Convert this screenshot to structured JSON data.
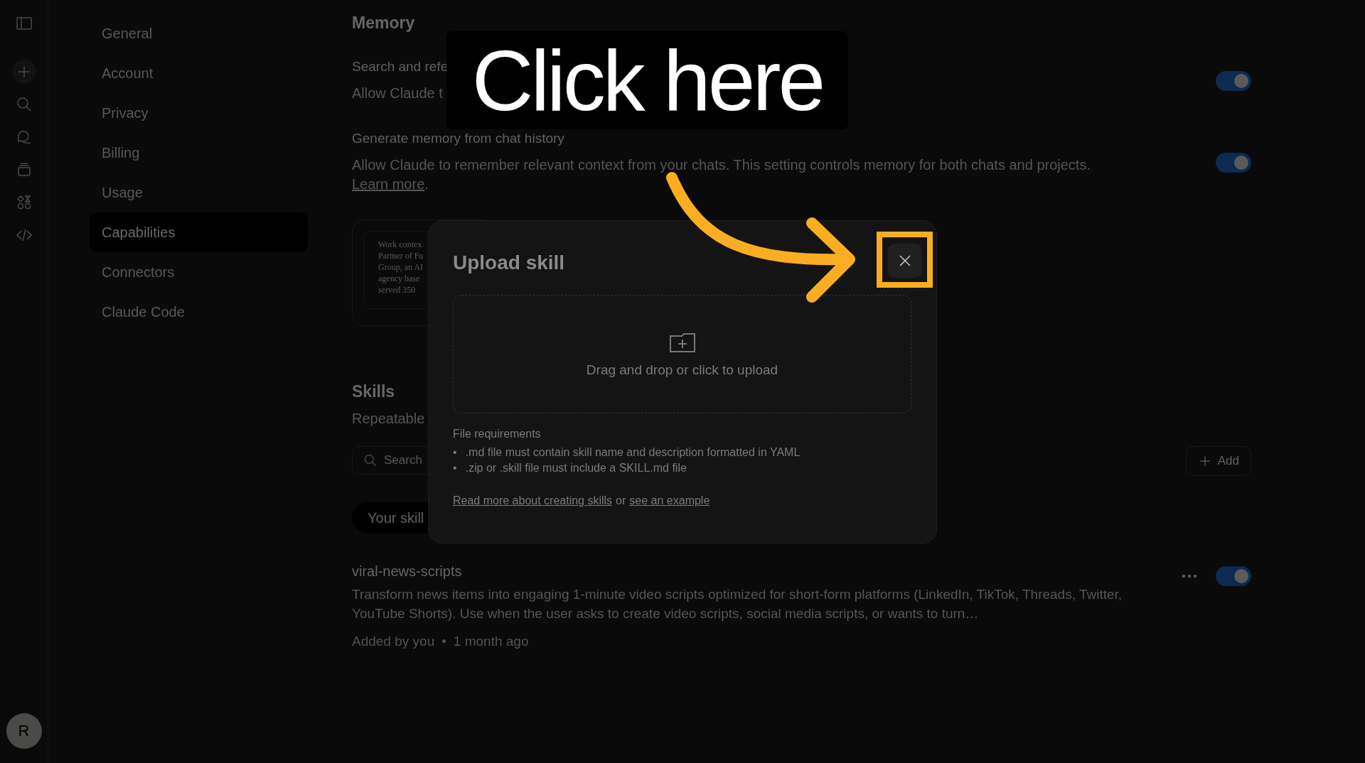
{
  "nav": [
    {
      "label": "General",
      "selected": false
    },
    {
      "label": "Account",
      "selected": false
    },
    {
      "label": "Privacy",
      "selected": false
    },
    {
      "label": "Billing",
      "selected": false
    },
    {
      "label": "Usage",
      "selected": false
    },
    {
      "label": "Capabilities",
      "selected": true
    },
    {
      "label": "Connectors",
      "selected": false
    },
    {
      "label": "Claude Code",
      "selected": false
    }
  ],
  "avatar": "R",
  "memory": {
    "title": "Memory",
    "settings": [
      {
        "title": "Search and refe",
        "description": "Allow Claude t",
        "on": true
      },
      {
        "title": "Generate memory from chat history",
        "description": "Allow Claude to remember relevant context from your chats. This setting controls memory for both chats and projects.",
        "link": "Learn more",
        "after_link": ".",
        "on": true
      }
    ],
    "card_lines": [
      "Work contex",
      "Partner of Fu",
      "Group, an AI",
      "agency base",
      "served 350"
    ]
  },
  "skills": {
    "title": "Skills",
    "subtitle": "Repeatable",
    "search": {
      "placeholder": "Search"
    },
    "add_button": "Add",
    "tab": "Your skill",
    "items": [
      {
        "name": "viral-news-scripts",
        "description": "Transform news items into engaging 1-minute video scripts optimized for short-form platforms (LinkedIn, TikTok, Threads, Twitter, YouTube Shorts). Use when the user asks to create video scripts, social media scripts, or wants to turn…",
        "added_by": "Added by you",
        "separator": "•",
        "age": "1 month ago",
        "on": true
      }
    ]
  },
  "modal": {
    "title": "Upload skill",
    "dropzone": "Drag and drop or click to upload",
    "requirements_title": "File requirements",
    "requirements": [
      {
        "bullet": "•",
        "text": ".md file must contain skill name and description formatted in YAML"
      },
      {
        "bullet": "•",
        "text": ".zip or .skill file must include a SKILL.md file"
      }
    ],
    "link_1": "Read more about creating skills",
    "joiner": "or",
    "link_2": "see an example"
  },
  "annotation": {
    "text": "Click here"
  }
}
